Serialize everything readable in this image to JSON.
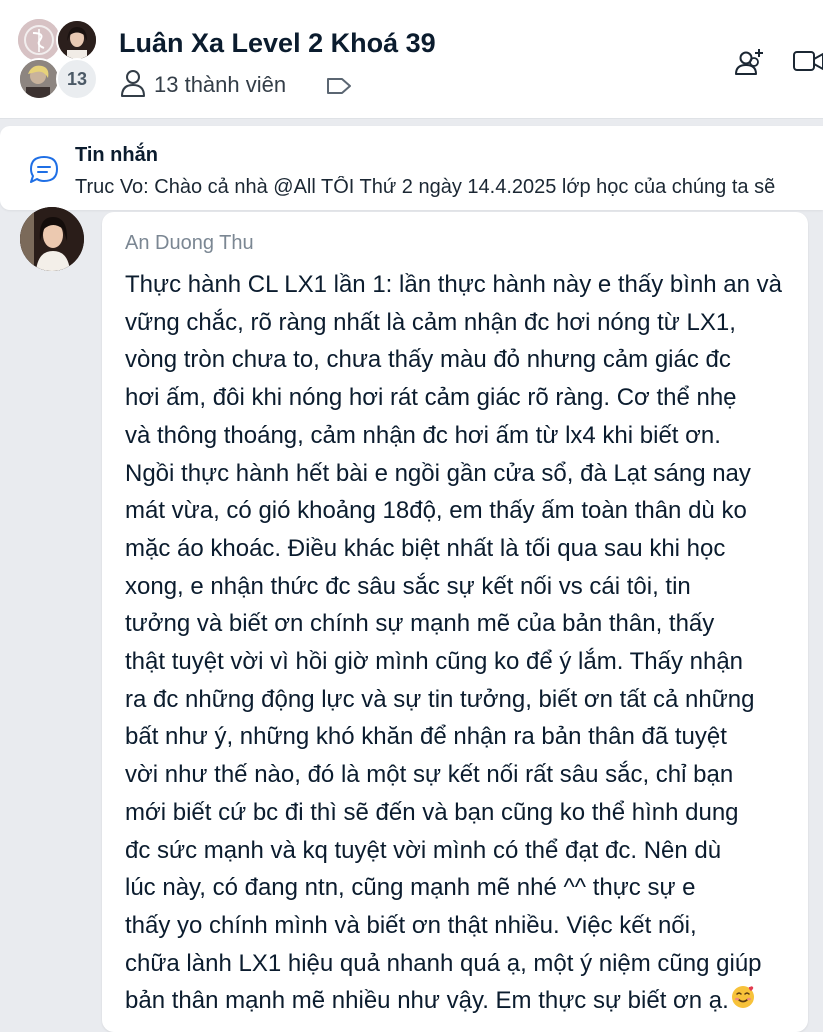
{
  "header": {
    "title": "Luân Xa Level 2 Khoá 39",
    "member_count_badge": "13",
    "members_label": "13 thành viên",
    "icons": {
      "members": "person-icon",
      "tag": "tag-icon",
      "add_member": "add-member-icon",
      "video": "video-call-icon"
    }
  },
  "pinned": {
    "title": "Tin nhắn",
    "text": "Truc Vo: Chào cả nhà @All  TỐI Thứ 2 ngày 14.4.2025 lớp học của chúng ta sẽ",
    "icon": "message-icon"
  },
  "message": {
    "sender": "An Duong Thu",
    "lines": [
      "Thực hành CL LX1 lần 1: lần thực hành này e thấy bình an và",
      "vững chắc,  rõ ràng nhất là cảm nhận đc hơi nóng từ LX1,",
      "vòng tròn chưa to, chưa thấy màu đỏ nhưng cảm giác đc",
      "hơi ấm, đôi khi nóng hơi rát cảm giác rõ ràng. Cơ thể nhẹ",
      "và thông thoáng, cảm nhận đc hơi ấm từ lx4 khi biết ơn.",
      "Ngồi thực hành hết bài e ngồi gần cửa sổ, đà Lạt sáng nay",
      "mát vừa, có gió khoảng 18độ, em thấy ấm toàn thân dù ko",
      "mặc áo khoác. Điều khác biệt nhất là tối qua sau khi học",
      "xong, e nhận thức đc sâu sắc sự kết nối vs cái tôi, tin",
      "tưởng và biết ơn chính sự mạnh mẽ của bản thân, thấy",
      "thật tuyệt vời vì hồi giờ mình cũng ko để ý lắm. Thấy nhận",
      "ra đc những động lực và sự tin tưởng, biết ơn tất cả những",
      "bất như ý, những khó khăn để nhận ra bản thân đã tuyệt",
      "vời như thế nào, đó là một sự kết nối rất sâu sắc, chỉ bạn",
      "mới biết cứ bc đi thì sẽ đến và bạn cũng ko thể hình dung",
      "đc sức mạnh và kq tuyệt vời mình có thể đạt đc. Nên dù",
      "lúc này, có đang ntn, cũng mạnh mẽ nhé ^^ thực sự e",
      "thấy yo chính mình và biết ơn thật nhiều. Việc kết nối,",
      "chữa lành LX1 hiệu quả nhanh quá ạ, một ý niệm cũng giúp",
      "bản thân mạnh mẽ nhiều như vậy. Em thực sự biết ơn ạ."
    ],
    "trailing_emoji": "smiling-face-with-hearts-icon"
  }
}
